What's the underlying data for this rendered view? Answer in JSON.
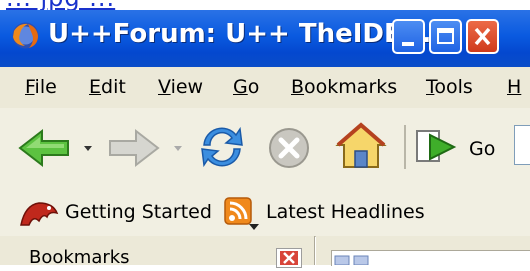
{
  "page_link": {
    "text": "... jpg ..."
  },
  "window": {
    "title": "U++Forum: U++ TheIDE..."
  },
  "menu": [
    "File",
    "Edit",
    "View",
    "Go",
    "Bookmarks",
    "Tools",
    "H"
  ],
  "nav": {
    "go_label": "Go"
  },
  "bookmarks_toolbar": {
    "items": [
      {
        "label": "Getting Started"
      },
      {
        "label": "Latest Headlines"
      }
    ]
  },
  "sidebar": {
    "title": "Bookmarks"
  },
  "colors": {
    "titlebar": "#0a5ae0",
    "menubar": "#ece9d8",
    "close_red": "#cf3a1c",
    "back_green": "#3aaa2a",
    "reload_blue": "#2a7ad6"
  }
}
